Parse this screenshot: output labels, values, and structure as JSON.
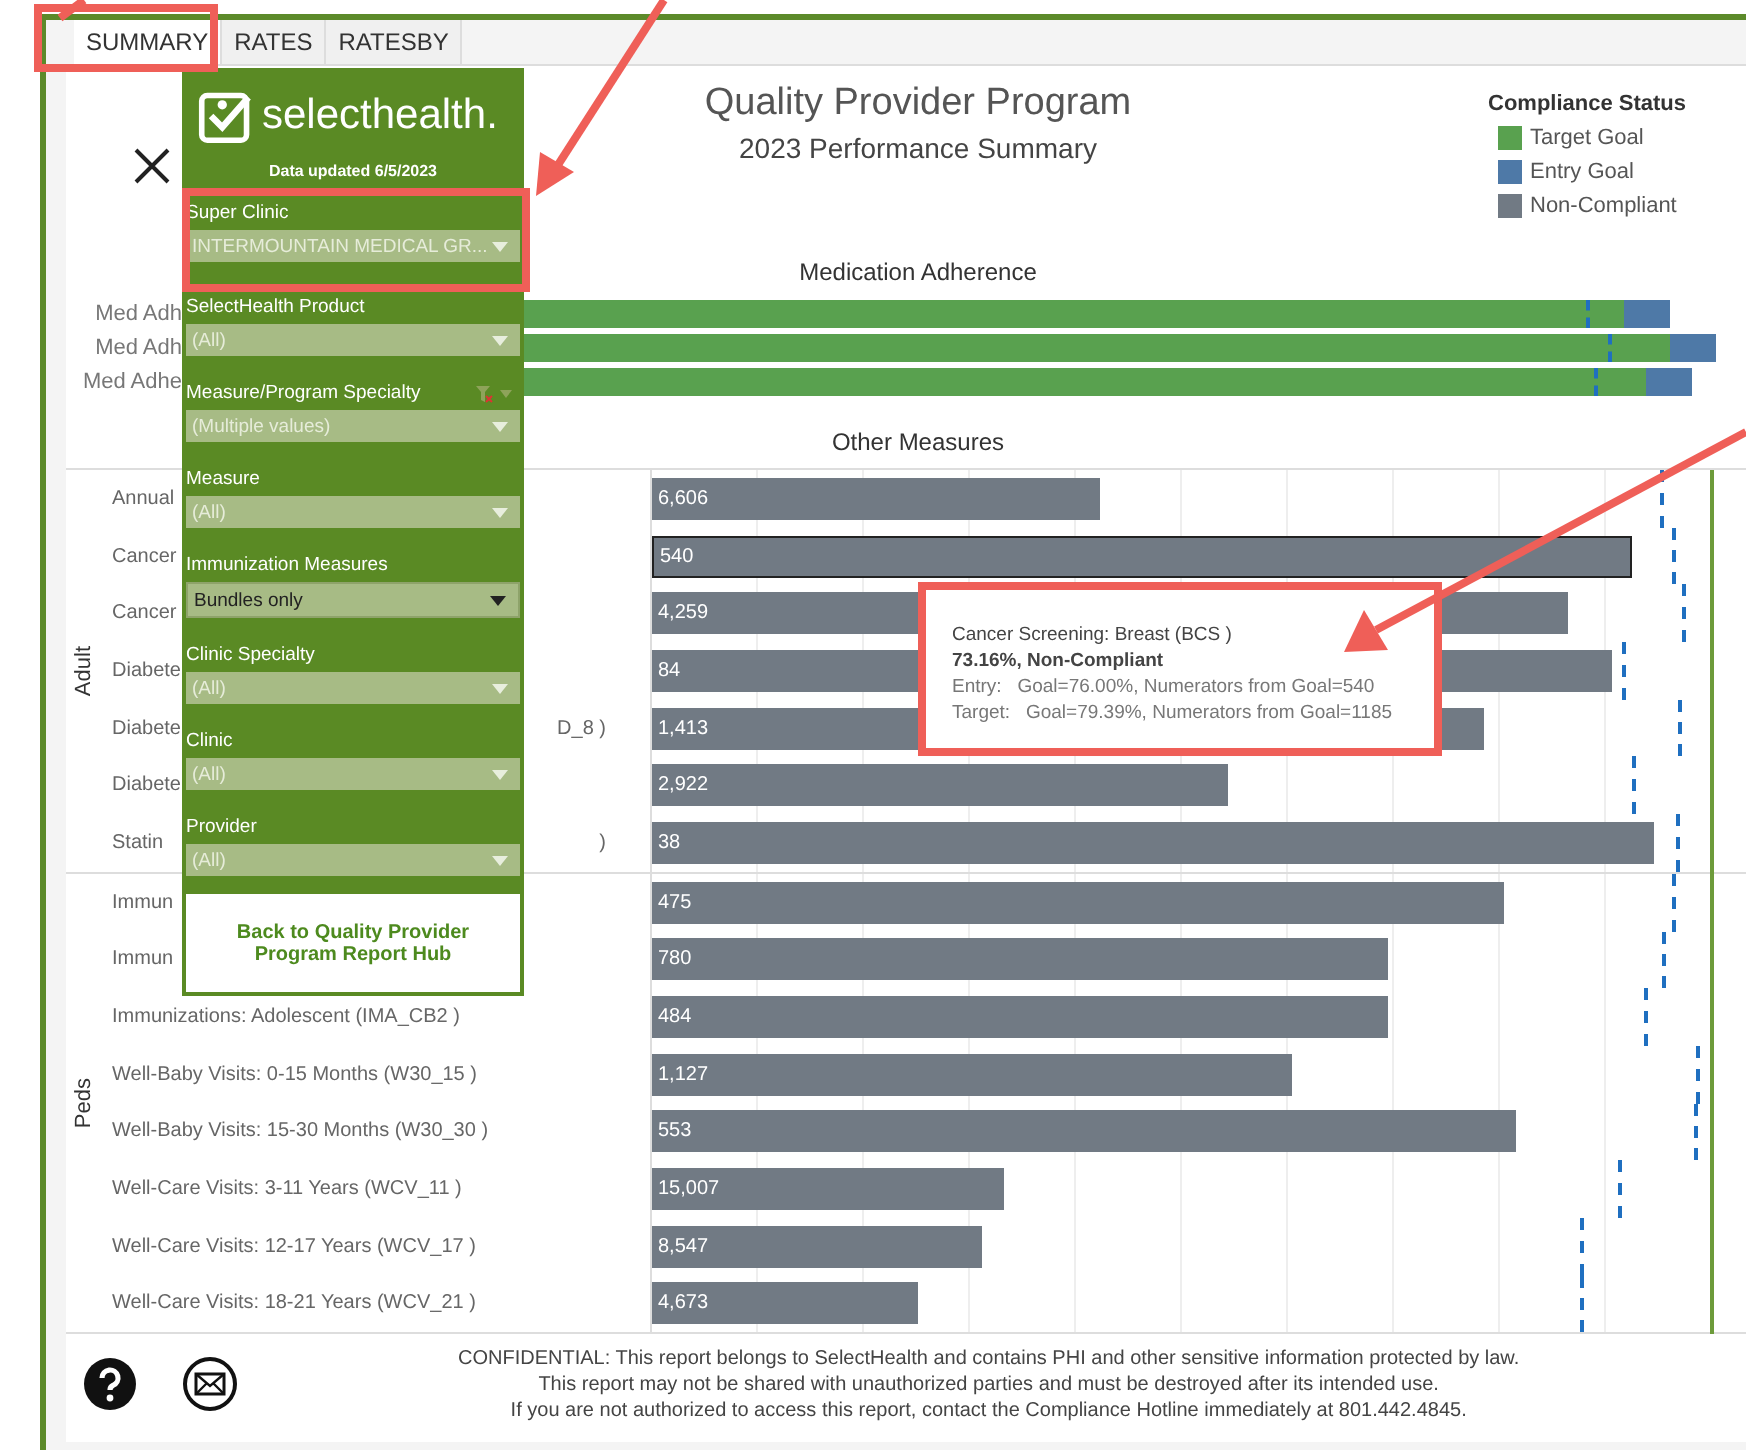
{
  "tabs": [
    {
      "label": "SUMMARY",
      "selected": true
    },
    {
      "label": "RATES",
      "selected": false
    },
    {
      "label": "RATESBY",
      "selected": false
    }
  ],
  "header": {
    "title": "Quality Provider Program",
    "subtitle": "2023 Performance Summary"
  },
  "legend": {
    "title": "Compliance Status",
    "items": [
      {
        "label": "Target Goal",
        "color": "#59a14f"
      },
      {
        "label": "Entry Goal",
        "color": "#4e79a7"
      },
      {
        "label": "Non-Compliant",
        "color": "#717a84"
      }
    ]
  },
  "medication": {
    "title": "Medication Adherence",
    "rows": [
      {
        "label": "Med Adh",
        "level": 0.94
      },
      {
        "label": "Med Adh",
        "level": 0.97
      },
      {
        "label": "Med Adhe",
        "level": 0.954
      }
    ]
  },
  "other": {
    "title": "Other Measures",
    "groups": [
      {
        "label": "Adult",
        "rows": [
          {
            "label": "Annual",
            "value": "6,606",
            "level": 0.42,
            "selected": false
          },
          {
            "label": "Cancer",
            "value": "540",
            "level": 0.92,
            "selected": true
          },
          {
            "label": "Cancer",
            "value": "4,259",
            "level": 0.86,
            "selected": false
          },
          {
            "label": "Diabete",
            "value": "84",
            "level": 0.9,
            "selected": false
          },
          {
            "label": "Diabete",
            "tail": "D_8 )",
            "value": "1,413",
            "level": 0.78,
            "selected": false
          },
          {
            "label": "Diabete",
            "value": "2,922",
            "level": 0.54,
            "selected": false
          },
          {
            "label": "Statin",
            "tail": ")",
            "value": "38",
            "level": 0.94,
            "selected": false
          }
        ]
      },
      {
        "label": "Peds",
        "rows": [
          {
            "label": "Immun",
            "value": "475",
            "level": 0.8,
            "selected": false
          },
          {
            "label": "Immun",
            "value": "780",
            "level": 0.69,
            "selected": false
          },
          {
            "label": "Immunizations: Adolescent (IMA_CB2 )",
            "value": "484",
            "level": 0.69,
            "selected": false
          },
          {
            "label": "Well-Baby Visits: 0-15 Months (W30_15 )",
            "value": "1,127",
            "level": 0.6,
            "selected": false
          },
          {
            "label": "Well-Baby Visits: 15-30 Months (W30_30 )",
            "value": "553",
            "level": 0.81,
            "selected": false
          },
          {
            "label": "Well-Care Visits: 3-11 Years (WCV_11 )",
            "value": "15,007",
            "level": 0.33,
            "selected": false
          },
          {
            "label": "Well-Care Visits: 12-17 Years (WCV_17 )",
            "value": "8,547",
            "level": 0.31,
            "selected": false
          },
          {
            "label": "Well-Care Visits: 18-21 Years (WCV_21 )",
            "value": "4,673",
            "level": 0.25,
            "selected": false
          }
        ]
      }
    ]
  },
  "tooltip": {
    "lines": [
      {
        "kind": "title",
        "text": "Cancer Screening: Breast (BCS )"
      },
      {
        "kind": "status",
        "text": "73.16%, Non-Compliant"
      },
      {
        "kind": "detail",
        "label": "Entry:",
        "text": "Goal=76.00%, Numerators from Goal=540"
      },
      {
        "kind": "detail",
        "label": "Target:",
        "text": "Goal=79.39%, Numerators from Goal=1185"
      }
    ]
  },
  "panel": {
    "logo_text": "selecthealth.",
    "updated": "Data updated 6/5/2023",
    "filters": [
      {
        "label": "Super Clinic",
        "value": "INTERMOUNTAIN MEDICAL GR...",
        "active": false,
        "filtered": false
      },
      {
        "label": "SelectHealth Product",
        "value": "(All)",
        "active": false,
        "filtered": false
      },
      {
        "label": "Measure/Program Specialty",
        "value": "(Multiple values)",
        "active": false,
        "filtered": true
      },
      {
        "label": "Measure",
        "value": "(All)",
        "active": false,
        "filtered": false
      },
      {
        "label": "Immunization Measures",
        "value": "Bundles only",
        "active": true,
        "filtered": false
      },
      {
        "label": "Clinic Specialty",
        "value": "(All)",
        "active": false,
        "filtered": false
      },
      {
        "label": "Clinic",
        "value": "(All)",
        "active": false,
        "filtered": false
      },
      {
        "label": "Provider",
        "value": "(All)",
        "active": false,
        "filtered": false
      }
    ],
    "back_button": "Back to Quality Provider Program Report Hub"
  },
  "footer": {
    "lines": [
      "CONFIDENTIAL: This report belongs to SelectHealth and contains PHI and other sensitive information protected by law.",
      "This report may not be shared with unauthorized parties and must be destroyed after its intended use.",
      "If you are not authorized to access this report, contact the Compliance Hotline immediately at 801.442.4845."
    ]
  }
}
